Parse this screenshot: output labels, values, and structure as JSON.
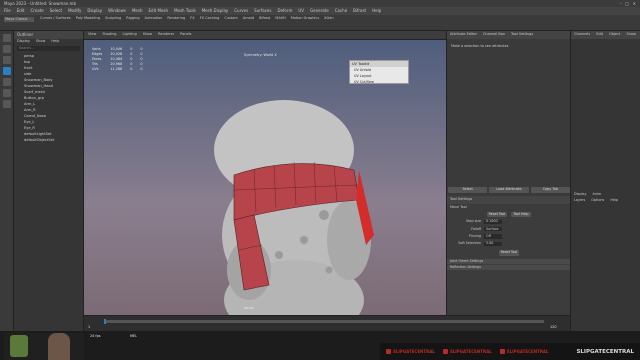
{
  "window": {
    "title": "Maya 2023 - Untitled: Snowman.mb"
  },
  "menubar": {
    "items": [
      "File",
      "Edit",
      "Create",
      "Select",
      "Modify",
      "Display",
      "Windows",
      "Mesh",
      "Edit Mesh",
      "Mesh Tools",
      "Mesh Display",
      "Curves",
      "Surfaces",
      "Deform",
      "UV",
      "Generate",
      "Cache",
      "Bifrost",
      "Help"
    ]
  },
  "shelf": {
    "tabs": [
      "Curves / Surfaces",
      "Poly Modeling",
      "Sculpting",
      "Rigging",
      "Animation",
      "Rendering",
      "FX",
      "FX Caching",
      "Custom",
      "Arnold",
      "Bifrost",
      "MASH",
      "Motion Graphics",
      "XGen"
    ],
    "workspace": "Maya Classic"
  },
  "outliner": {
    "title": "Outliner",
    "menu": [
      "Display",
      "Show",
      "Help"
    ],
    "search_placeholder": "Search...",
    "items": [
      "persp",
      "top",
      "front",
      "side",
      "Snowman_Body",
      "Snowman_Head",
      "Scarf_mesh",
      "Button_grp",
      "Arm_L",
      "Arm_R",
      "Carrot_Nose",
      "Eye_L",
      "Eye_R",
      "defaultLightSet",
      "defaultObjectSet"
    ]
  },
  "viewport": {
    "menu": [
      "View",
      "Shading",
      "Lighting",
      "Show",
      "Renderer",
      "Panels"
    ],
    "camera_label": "persp",
    "symmetry": "Symmetry: World X",
    "stats_rows": [
      [
        "Verts",
        "10,446",
        "0",
        "0"
      ],
      [
        "Edges",
        "20,928",
        "0",
        "0"
      ],
      [
        "Faces",
        "10,484",
        "0",
        "0"
      ],
      [
        "Tris",
        "20,968",
        "0",
        "0"
      ],
      [
        "UVs",
        "11,288",
        "0",
        "0"
      ]
    ],
    "popup": {
      "title": "UV Toolkit",
      "items": [
        "UV Unfold",
        "UV Layout",
        "UV Cut/Sew"
      ]
    }
  },
  "attribute_editor": {
    "menu": [
      "Attribute Editor",
      "Channel Box",
      "Tool Settings"
    ],
    "hint": "Make a selection to see attributes",
    "tabs": [
      "Select",
      "Load Attributes",
      "Copy Tab"
    ],
    "tool_settings": {
      "title": "Tool Settings",
      "sub": "Move Tool",
      "reset_label": "Reset Tool",
      "help_label": "Tool Help",
      "rows": [
        {
          "label": "Step size",
          "value": "0.1000"
        },
        {
          "label": "Falloff",
          "value": "Surface"
        },
        {
          "label": "Pinning",
          "value": "Off"
        },
        {
          "label": "Soft Selection",
          "value": "5.00"
        }
      ],
      "section_1": "Joint Orient Settings",
      "section_2": "Reflection Settings",
      "apply_label": "Reset Tool"
    }
  },
  "far_right": {
    "menu": [
      "Channels",
      "Edit",
      "Object",
      "Show"
    ],
    "layers_menu": [
      "Display",
      "Anim"
    ],
    "layer_tabs": [
      "Layers",
      "Options",
      "Help"
    ]
  },
  "timeline": {
    "start": "1",
    "end": "120",
    "current": "1"
  },
  "bottom": {
    "fps": "24 fps",
    "status": "MEL"
  },
  "banner": {
    "socials": [
      "SLIPGATECENTRAL",
      "SLIPGATECENTRAL",
      "SLIPGATECENTRAL"
    ],
    "brand": "SLIPGATECENTRAL"
  },
  "colors": {
    "accent": "#2a7fc1",
    "scarf": "#b6444a",
    "snowman": "#c7c7c7",
    "banner_red": "#b92a2a"
  }
}
